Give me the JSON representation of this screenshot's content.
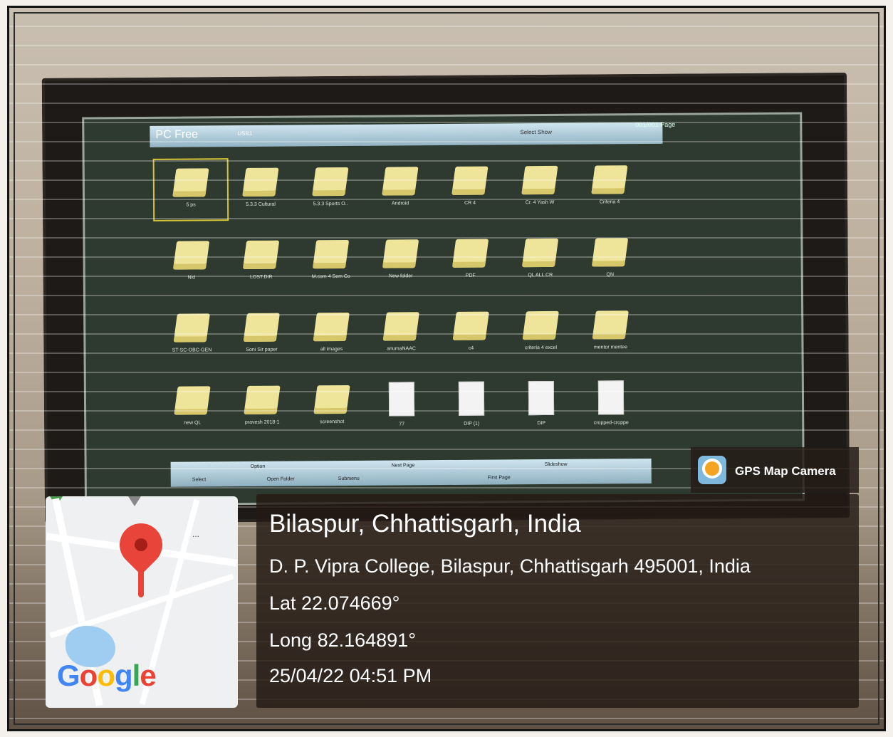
{
  "screen": {
    "header_title": "PC Free",
    "header_source": "USB1",
    "header_page": "001/001 Page",
    "header_slideshow": "Select Show",
    "folders": [
      {
        "label": "5 ps",
        "kind": "folder",
        "selected": true
      },
      {
        "label": "5.3.3 Cultural",
        "kind": "folder"
      },
      {
        "label": "5.3.3 Sports O..",
        "kind": "folder"
      },
      {
        "label": "Android",
        "kind": "folder"
      },
      {
        "label": "CR 4",
        "kind": "folder"
      },
      {
        "label": "Cr. 4 Yash W",
        "kind": "folder"
      },
      {
        "label": "Criteria 4",
        "kind": "folder"
      },
      {
        "label": "Nid",
        "kind": "folder"
      },
      {
        "label": "LOST.DIR",
        "kind": "folder"
      },
      {
        "label": "M.com 4 Sem Co",
        "kind": "folder"
      },
      {
        "label": "New folder",
        "kind": "folder"
      },
      {
        "label": "PDF",
        "kind": "folder"
      },
      {
        "label": "QL ALL CR",
        "kind": "folder"
      },
      {
        "label": "QN",
        "kind": "folder"
      },
      {
        "label": "ST-SC-OBC-GEN",
        "kind": "folder"
      },
      {
        "label": "Soni Sir paper",
        "kind": "folder"
      },
      {
        "label": "all images",
        "kind": "folder"
      },
      {
        "label": "anumaNAAC",
        "kind": "folder"
      },
      {
        "label": "c4",
        "kind": "folder"
      },
      {
        "label": "criteria 4 excel",
        "kind": "folder"
      },
      {
        "label": "mentor mentee",
        "kind": "folder"
      },
      {
        "label": "new QL",
        "kind": "folder"
      },
      {
        "label": "pravesh 2018-1",
        "kind": "folder"
      },
      {
        "label": "screenshot",
        "kind": "folder"
      },
      {
        "label": "77",
        "kind": "file"
      },
      {
        "label": "DIP (1)",
        "kind": "file"
      },
      {
        "label": "DIP",
        "kind": "file"
      },
      {
        "label": "cropped-croppe",
        "kind": "file"
      }
    ],
    "footer": {
      "option": "Option",
      "next_page": "Next Page",
      "slideshow": "Slideshow",
      "select": "Select",
      "open_folder": "Open Folder",
      "submenu": "Submenu",
      "first_page": "First Page"
    }
  },
  "gps": {
    "app_name": "GPS Map Camera",
    "place": "Bilaspur, Chhattisgarh, India",
    "address": "D. P. Vipra College, Bilaspur, Chhattisgarh 495001, India",
    "lat": "Lat 22.074669°",
    "long": "Long 82.164891°",
    "datetime": "25/04/22 04:51 PM"
  },
  "map": {
    "logo_text": "Google",
    "menu_dots": "...",
    "pin_icon": "map-pin-icon"
  },
  "colors": {
    "folder": "#efe59a",
    "screen_bg": "#2e3a30",
    "overlay_bg": "#231a14",
    "pin": "#e8443a"
  }
}
